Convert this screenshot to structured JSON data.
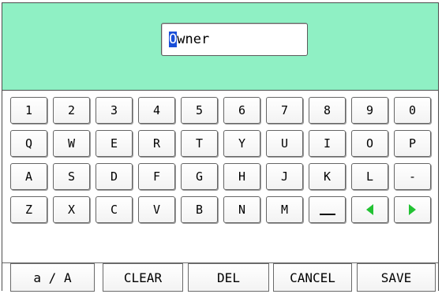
{
  "input": {
    "first_char": "O",
    "rest": "wner"
  },
  "keyboard": {
    "rows": [
      [
        "1",
        "2",
        "3",
        "4",
        "5",
        "6",
        "7",
        "8",
        "9",
        "0"
      ],
      [
        "Q",
        "W",
        "E",
        "R",
        "T",
        "Y",
        "U",
        "I",
        "O",
        "P"
      ],
      [
        "A",
        "S",
        "D",
        "F",
        "G",
        "H",
        "J",
        "K",
        "L",
        "-"
      ],
      [
        "Z",
        "X",
        "C",
        "V",
        "B",
        "N",
        "M",
        "space",
        "left-arrow",
        "right-arrow"
      ]
    ]
  },
  "bottom": {
    "case": "a / A",
    "clear": "CLEAR",
    "del": "DEL",
    "cancel": "CANCEL",
    "save": "SAVE"
  },
  "colors": {
    "header": "#8ff0c4",
    "cursor": "#1a4fd8",
    "arrow": "#22c233"
  }
}
